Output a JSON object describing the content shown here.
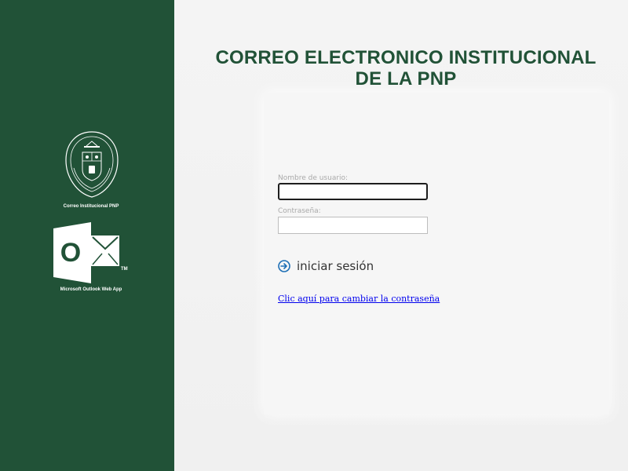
{
  "branding": {
    "emblem_caption": "Correo Institucional PNP",
    "outlook_caption": "Microsoft Outlook Web App",
    "outlook_logo_letter": "O",
    "outlook_trademark": "TM",
    "sidebar_color": "#215237",
    "title_color": "#215237"
  },
  "header": {
    "title_line1": "CORREO ELECTRONICO INSTITUCIONAL",
    "title_line2": "DE LA PNP"
  },
  "form": {
    "username_label": "Nombre de usuario:",
    "username_value": "",
    "password_label": "Contraseña:",
    "password_value": "",
    "signin_label": "iniciar sesión",
    "signin_icon": "arrow-right-circle-icon",
    "change_password_link": "Clic aquí para cambiar la contraseña"
  }
}
